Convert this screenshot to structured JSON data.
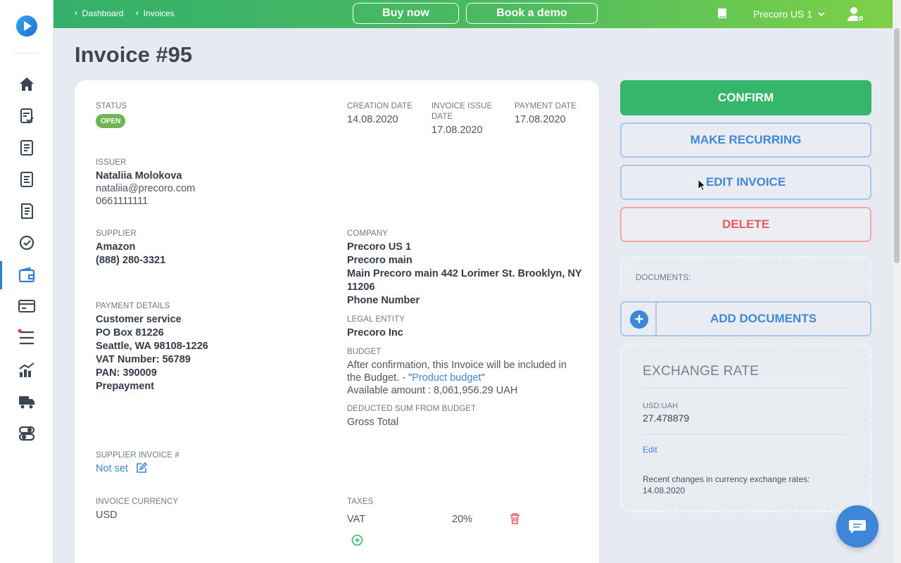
{
  "topbar": {
    "breadcrumbs": [
      "Dashboard",
      "Invoices"
    ],
    "buy_now": "Buy now",
    "book_demo": "Book a demo",
    "org_name": "Precoro US 1"
  },
  "page": {
    "title": "Invoice #95"
  },
  "invoice": {
    "status_label": "STATUS",
    "status_value": "OPEN",
    "creation_date_label": "CREATION DATE",
    "creation_date": "14.08.2020",
    "issue_date_label_1": "INVOICE ISSUE",
    "issue_date_label_2": "DATE",
    "issue_date": "17.08.2020",
    "payment_date_label": "PAYMENT DATE",
    "payment_date": "17.08.2020",
    "issuer_label": "ISSUER",
    "issuer_name": "Nataliia Molokova",
    "issuer_email": "nataliia@precoro.com",
    "issuer_phone": "0661111111",
    "supplier_label": "SUPPLIER",
    "supplier_name": "Amazon",
    "supplier_phone": "(888) 280-3321",
    "company_label": "COMPANY",
    "company_lines": [
      "Precoro US 1",
      "Precoro main",
      "Main Precoro main 442 Lorimer St. Brooklyn, NY",
      "11206",
      "Phone Number"
    ],
    "payment_details_label": "PAYMENT DETAILS",
    "payment_details": [
      "Customer service",
      "PO Box 81226",
      "Seattle, WA 98108-1226",
      "VAT Number: 56789",
      "PAN: 390009",
      "Prepayment"
    ],
    "legal_entity_label": "LEGAL ENTITY",
    "legal_entity": "Precoro Inc",
    "budget_label": "BUDGET",
    "budget_text_1": "After confirmation, this Invoice will be included in",
    "budget_text_2a": "the Budget. - \"",
    "budget_link": "Product budget",
    "budget_text_2b": "\"",
    "budget_available": "Available amount : 8,061,956.29 UAH",
    "deducted_label": "DEDUCTED SUM FROM BUDGET",
    "deducted_value": "Gross Total",
    "supplier_invoice_label": "SUPPLIER INVOICE #",
    "supplier_invoice_value": "Not set",
    "currency_label": "INVOICE CURRENCY",
    "currency_value": "USD",
    "taxes_label": "TAXES",
    "tax_name": "VAT",
    "tax_rate": "20%"
  },
  "actions": {
    "confirm": "CONFIRM",
    "make_recurring": "MAKE RECURRING",
    "edit_invoice": "EDIT INVOICE",
    "delete": "DELETE"
  },
  "documents": {
    "label": "DOCUMENTS:",
    "add_button": "ADD DOCUMENTS"
  },
  "exchange_rate": {
    "title": "EXCHANGE RATE",
    "pair_label": "USD:UAH",
    "rate": "27.478879",
    "edit_link": "Edit",
    "recent_text": "Recent changes in currency exchange rates:",
    "recent_date": "14.08.2020"
  },
  "colors": {
    "topbar_start": "#33b06b",
    "topbar_end": "#7dd147",
    "confirm": "#35b66a",
    "link": "#3d86d8",
    "danger": "#e95a5a",
    "status_open": "#6fb553"
  },
  "icons": {
    "sidebar": [
      "home-icon",
      "requisitions-icon",
      "purchase-orders-icon",
      "receipts-icon",
      "invoices-icon",
      "approvals-icon",
      "wallet-icon",
      "payments-icon",
      "tasks-icon",
      "analytics-icon",
      "suppliers-icon",
      "settings-icon"
    ]
  }
}
